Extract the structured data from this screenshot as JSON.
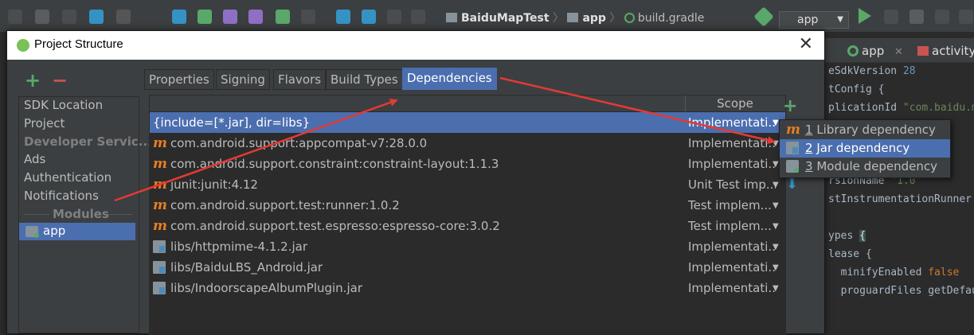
{
  "ide": {
    "breadcrumb": [
      "BaiduMapTest",
      "app",
      "build.gradle"
    ],
    "run_config": "app",
    "editor_tabs": [
      "app",
      "activity"
    ],
    "code_lines": [
      {
        "text": "eSdkVersion ",
        "num": "28"
      },
      {
        "text": "tConfig {"
      },
      {
        "text": "plicationId ",
        "str": "\"com.baidu.m"
      },
      {
        "text": "rsionName ",
        "str": "\"1.0\""
      },
      {
        "text": "stInstrumentationRunner"
      },
      {
        "text": "ypes ",
        "brace": "{"
      },
      {
        "text": "lease {"
      },
      {
        "text": "  minifyEnabled ",
        "kw": "false"
      },
      {
        "text": "  proguardFiles getDefau"
      }
    ]
  },
  "dialog": {
    "title": "Project Structure",
    "close": "✕",
    "add_symbol": "+",
    "remove_symbol": "−",
    "sidebar": [
      {
        "label": "SDK Location",
        "header": false
      },
      {
        "label": "Project",
        "header": false
      },
      {
        "label": "Developer Servic...",
        "header": true
      },
      {
        "label": "Ads",
        "header": false
      },
      {
        "label": "Authentication",
        "header": false
      },
      {
        "label": "Notifications",
        "header": false
      },
      {
        "label": "Modules",
        "header": true
      },
      {
        "label": "app",
        "header": false,
        "selected": true
      }
    ],
    "tabs": [
      {
        "label": "Properties",
        "active": false
      },
      {
        "label": "Signing",
        "active": false
      },
      {
        "label": "Flavors",
        "active": false
      },
      {
        "label": "Build Types",
        "active": false
      },
      {
        "label": "Dependencies",
        "active": true
      }
    ],
    "table": {
      "scope_header": "Scope",
      "rows": [
        {
          "name": "{include=[*.jar], dir=libs}",
          "scope": "Implementati...",
          "icon": "none",
          "selected": true
        },
        {
          "name": "com.android.support:appcompat-v7:28.0.0",
          "scope": "Implementati...",
          "icon": "maven-icon"
        },
        {
          "name": "com.android.support.constraint:constraint-layout:1.1.3",
          "scope": "Implementati...",
          "icon": "maven-icon"
        },
        {
          "name": "junit:junit:4.12",
          "scope": "Unit Test imp...",
          "icon": "maven-icon"
        },
        {
          "name": "com.android.support.test:runner:1.0.2",
          "scope": "Test implem...",
          "icon": "maven-icon"
        },
        {
          "name": "com.android.support.test.espresso:espresso-core:3.0.2",
          "scope": "Test implem...",
          "icon": "maven-icon"
        },
        {
          "name": "libs/httpmime-4.1.2.jar",
          "scope": "Implementati...",
          "icon": "jar-icon"
        },
        {
          "name": "libs/BaiduLBS_Android.jar",
          "scope": "Implementati...",
          "icon": "jar-icon"
        },
        {
          "name": "libs/IndoorscapeAlbumPlugin.jar",
          "scope": "Implementati...",
          "icon": "jar-icon"
        }
      ]
    },
    "add_menu": [
      {
        "number": "1",
        "label": "Library dependency",
        "icon": "maven-icon",
        "highlighted": false
      },
      {
        "number": "2",
        "label": "Jar dependency",
        "icon": "jar-icon",
        "highlighted": true
      },
      {
        "number": "3",
        "label": "Module dependency",
        "icon": "folder-icon",
        "highlighted": false
      }
    ],
    "down_symbol": "⬇",
    "maven_glyph": "m"
  },
  "colors": {
    "accent": "#4b6eaf",
    "annotation_arrow": "#e53935",
    "maven": "#e67e22",
    "add": "#59a869",
    "remove": "#c75450"
  }
}
